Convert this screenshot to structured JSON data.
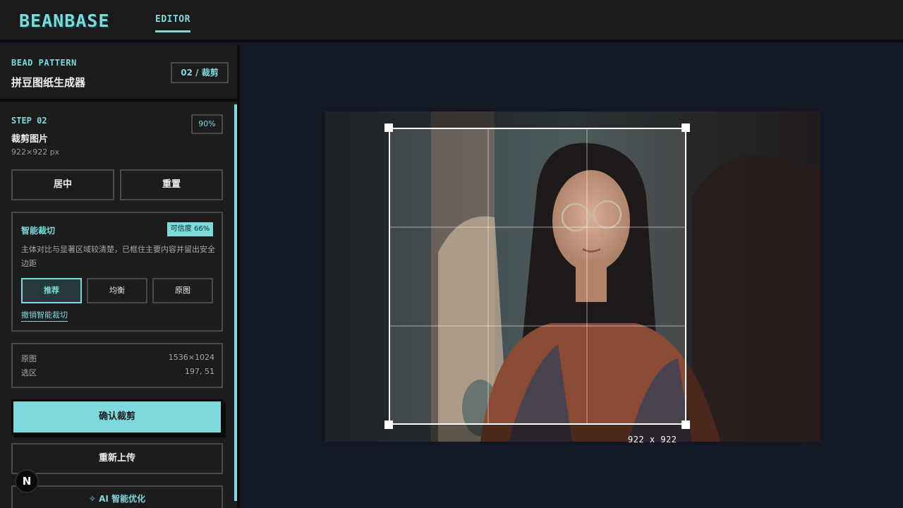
{
  "header": {
    "logo": "BEANBASE",
    "tab_editor": "EDITOR"
  },
  "sidebar": {
    "kicker": "BEAD PATTERN",
    "app_name": "拼豆图纸生成器",
    "step_badge": "02 / 裁剪",
    "step_kicker": "STEP 02",
    "step_title": "裁剪图片",
    "step_sub": "922×922 px",
    "zoom": "90%",
    "btn_center": "居中",
    "btn_reset": "重置",
    "smart": {
      "title": "智能裁切",
      "confidence": "可信度 66%",
      "desc": "主体对比与显著区域较清楚，已框住主要内容并留出安全边距",
      "modes": [
        "推荐",
        "均衡",
        "原图"
      ],
      "undo": "撤销智能裁切"
    },
    "info": {
      "orig_label": "原图",
      "orig_value": "1536×1024",
      "sel_label": "选区",
      "sel_value": "197, 51"
    },
    "btn_confirm": "确认裁剪",
    "btn_reupload": "重新上传",
    "btn_ai": "AI 智能优化",
    "avatar_letter": "N"
  },
  "canvas": {
    "crop_size": "922 x 922"
  },
  "colors": {
    "accent": "#7dd9db",
    "panel": "#1c1c1c",
    "canvas_bg": "#131826"
  }
}
